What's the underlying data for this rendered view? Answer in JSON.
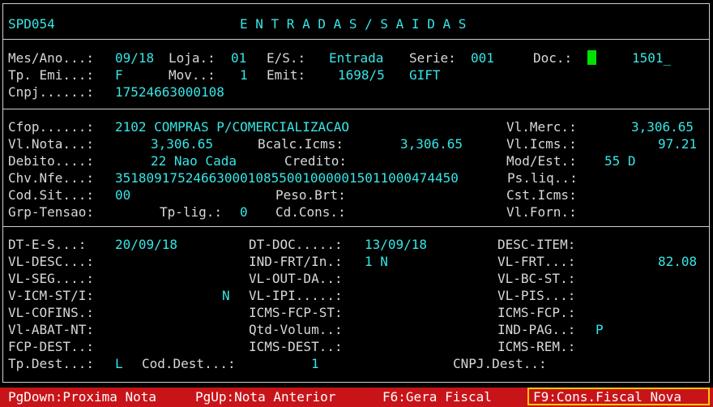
{
  "header": {
    "code": "SPD054",
    "title": "E N T R A D A S / S A I D A S"
  },
  "doc": {
    "mes_ano_label": "Mes/Ano...:",
    "mes_ano": "09/18",
    "loja_label": "Loja.:",
    "loja": "01",
    "es_label": "E/S.:",
    "es": "Entrada",
    "serie_label": "Serie:",
    "serie": "001",
    "doc_label": "Doc.:",
    "doc": "1501_",
    "tp_emi_label": "Tp. Emi...:",
    "tp_emi": "F",
    "mov_label": "Mov..:",
    "mov": "1",
    "emit_label": "Emit:",
    "emit": "1698/5",
    "emit_name": "GIFT",
    "cnpj_label": "Cnpj......:",
    "cnpj": "17524663000108"
  },
  "fiscal": {
    "cfop_label": "Cfop......:",
    "cfop": "2102 COMPRAS P/COMERCIALIZACAO",
    "vl_merc_label": "Vl.Merc.:",
    "vl_merc": "3,306.65",
    "vl_nota_label": "Vl.Nota...:",
    "vl_nota": "3,306.65",
    "bcalc_label": "Bcalc.Icms:",
    "bcalc": "3,306.65",
    "vl_icms_label": "Vl.Icms.:",
    "vl_icms": "97.21",
    "debito_label": "Debito....:",
    "debito": "22 Nao Cada",
    "credito_label": "Credito:",
    "mod_est_label": "Mod/Est.:",
    "mod_est": "55 D",
    "chv_label": "Chv.Nfe...:",
    "chv": "35180917524663000108550010000015011000474450",
    "ps_liq_label": "Ps.liq..:",
    "cod_sit_label": "Cod.Sit...:",
    "cod_sit": "00",
    "peso_brt_label": "Peso.Brt:",
    "cst_icms_label": "Cst.Icms:",
    "grp_tensao_label": "Grp-Tensao:",
    "tp_lig_label": "Tp-lig.:",
    "tp_lig": "0",
    "cd_cons_label": "Cd.Cons.:",
    "vl_forn_label": "Vl.Forn.:"
  },
  "detail": {
    "dt_es_label": "DT-E-S...:",
    "dt_es": "20/09/18",
    "dt_doc_label": "DT-DOC.....:",
    "dt_doc": "13/09/18",
    "desc_item_label": "DESC-ITEM:",
    "vl_desc_label": "VL-DESC...:",
    "ind_frt_label": "IND-FRT/In.:",
    "ind_frt": "1 N",
    "vl_frt_label": "VL-FRT...:",
    "vl_frt": "82.08",
    "vl_seg_label": "VL-SEG....:",
    "vl_out_da_label": "VL-OUT-DA..:",
    "vl_bc_st_label": "VL-BC-ST.:",
    "v_icm_st_label": "V-ICM-ST/I:",
    "v_icm_st": "N",
    "vl_ipi_label": "VL-IPI.....:",
    "vl_pis_label": "VL-PIS...:",
    "vl_cofins_label": "VL-COFINS.:",
    "icms_fcp_st_label": "ICMS-FCP-ST:",
    "icms_fcp_label": "ICMS-FCP.:",
    "vl_abat_label": "Vl-ABAT-NT:",
    "qtd_volum_label": "Qtd-Volum..:",
    "ind_pag_label": "IND-PAG..:",
    "ind_pag": "P",
    "fcp_dest_label": "FCP-DEST..:",
    "icms_dest_label": "ICMS-DEST..:",
    "icms_rem_label": "ICMS-REM.:",
    "tp_dest_label": "Tp.Dest...:",
    "tp_dest": "L",
    "cod_dest_label": "Cod.Dest...:",
    "cod_dest": "1",
    "cnpj_dest_label": "CNPJ.Dest..:"
  },
  "status_bar": {
    "pgdown": "PgDown:Proxima Nota",
    "pgup": "PgUp:Nota Anterior",
    "f6": "F6:Gera Fiscal",
    "f9": "F9:Cons.Fiscal Nova"
  },
  "colors": {
    "label": "#d8d8d8",
    "value": "#37e6e6",
    "background": "#000000",
    "status_bar": "#c81418",
    "cursor": "#00e000",
    "highlight": "#ffcc00"
  }
}
